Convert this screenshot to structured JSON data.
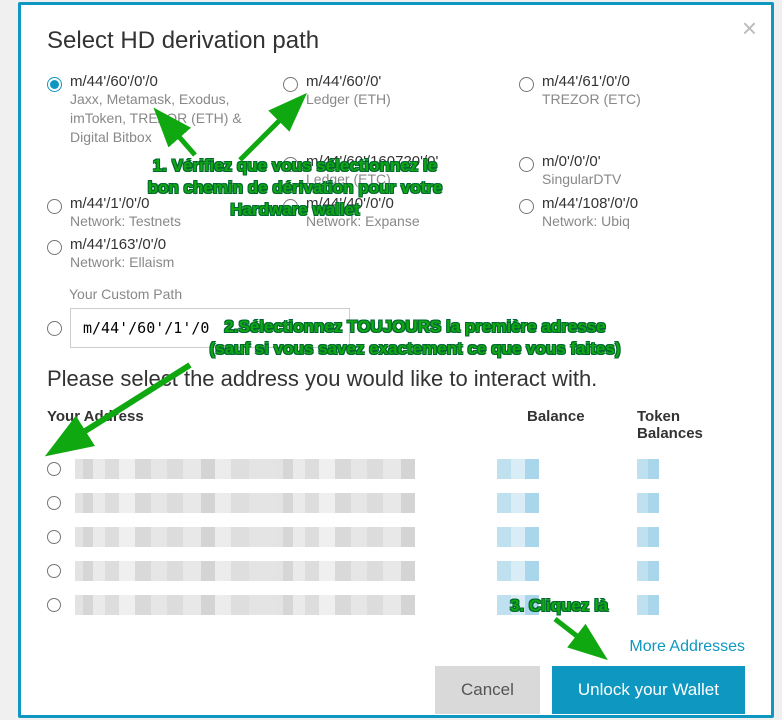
{
  "modal": {
    "title": "Select HD derivation path",
    "paths": [
      {
        "path": "m/44'/60'/0'/0",
        "desc": "Jaxx, Metamask, Exodus, imToken, TREZOR (ETH) & Digital Bitbox",
        "selected": true
      },
      {
        "path": "m/44'/60'/0'",
        "desc": "Ledger (ETH)"
      },
      {
        "path": "m/44'/61'/0'/0",
        "desc": "TREZOR (ETC)"
      },
      {
        "path": "",
        "desc": ""
      },
      {
        "path": "m/44'/60'/160720'/0'",
        "desc": "Ledger (ETC)"
      },
      {
        "path": "m/0'/0'/0'",
        "desc": "SingularDTV"
      },
      {
        "path": "m/44'/1'/0'/0",
        "desc": "Network: Testnets"
      },
      {
        "path": "m/44'/40'/0'/0",
        "desc": "Network: Expanse"
      },
      {
        "path": "m/44'/108'/0'/0",
        "desc": "Network: Ubiq"
      },
      {
        "path": "m/44'/163'/0'/0",
        "desc": "Network: Ellaism"
      }
    ],
    "custom_label": "Your Custom Path",
    "custom_value": "m/44'/60'/1'/0",
    "select_address_title": "Please select the address you would like to interact with.",
    "headers": {
      "address": "Your Address",
      "balance": "Balance",
      "token": "Token Balances"
    },
    "more": "More Addresses",
    "cancel": "Cancel",
    "unlock": "Unlock your Wallet"
  },
  "annotations": {
    "a1": "1. Vérifiez que vous sélectionnez le bon chemin de dérivation pour votre Hardware wallet",
    "a2_l1": "2.Sélectionnez TOUJOURS la première adresse",
    "a2_l2": "(sauf si vous savez exactement ce que vous faites)",
    "a3": "3. Cliquez là"
  }
}
